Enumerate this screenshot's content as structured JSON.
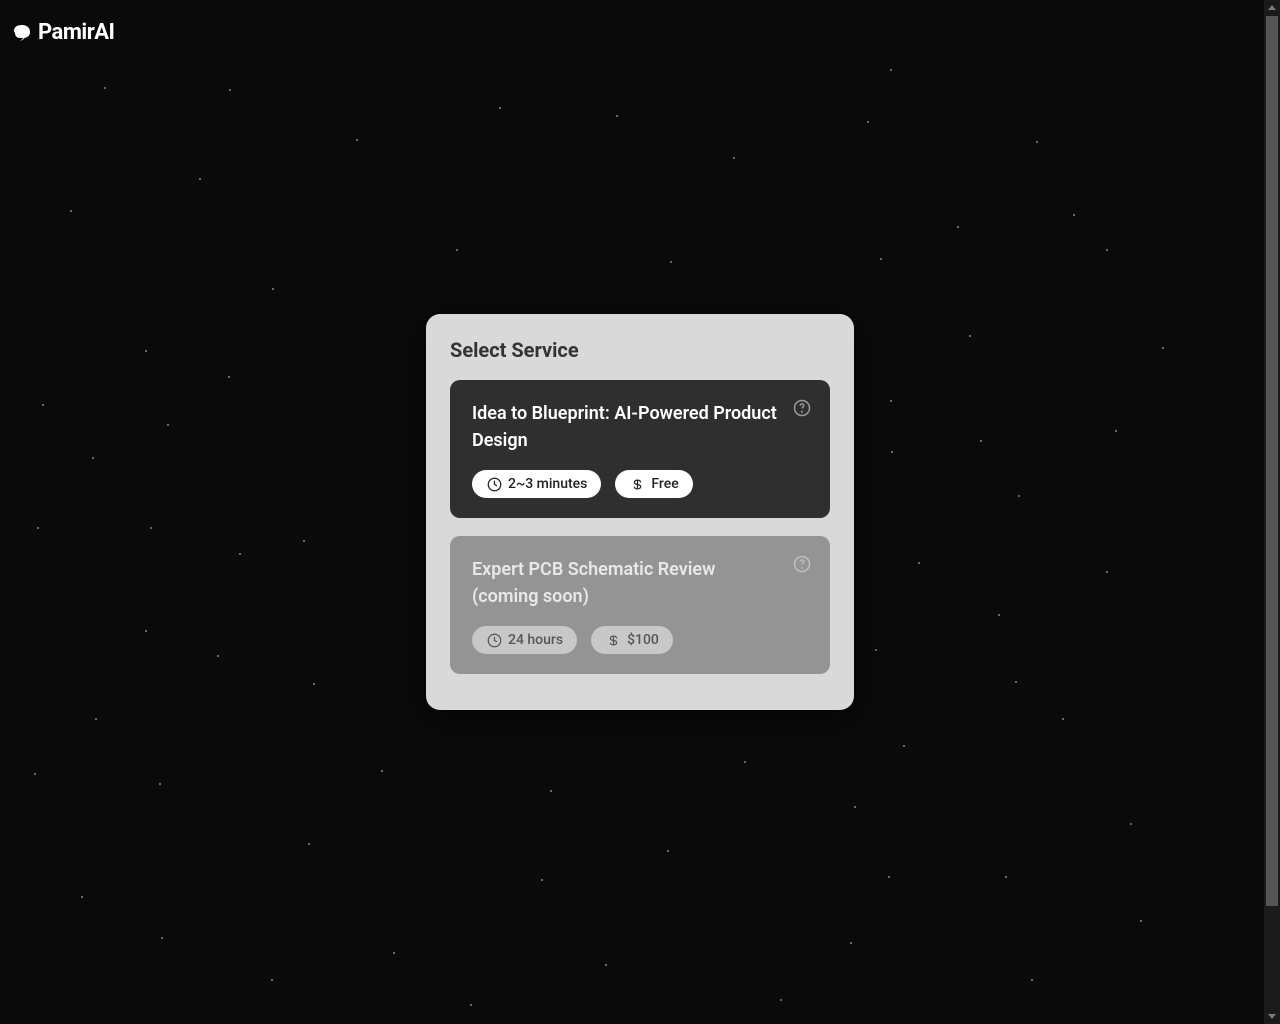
{
  "brand": {
    "name": "PamirAI"
  },
  "modal": {
    "title": "Select Service",
    "services": [
      {
        "title": "Idea to Blueprint: AI-Powered Product Design",
        "time": "2~3 minutes",
        "price": "Free",
        "state": "active"
      },
      {
        "title": "Expert PCB Schematic Review (coming soon)",
        "time": "24 hours",
        "price": "$100",
        "state": "disabled"
      }
    ]
  }
}
